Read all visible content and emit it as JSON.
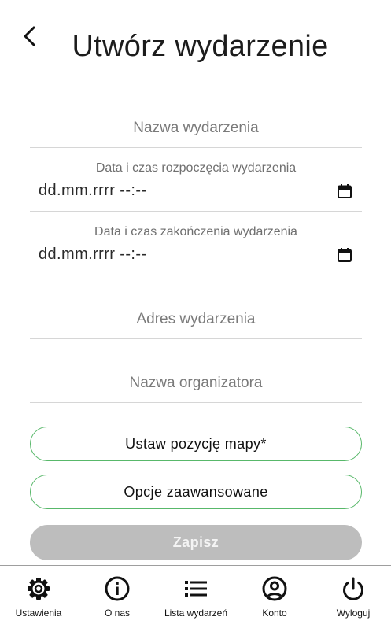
{
  "header": {
    "title": "Utwórz wydarzenie",
    "back_icon": "chevron-left-icon"
  },
  "form": {
    "event_name": {
      "placeholder": "Nazwa wydarzenia",
      "value": ""
    },
    "start_datetime": {
      "label": "Data i czas rozpoczęcia wydarzenia",
      "value": "dd.mm.rrrr --:--",
      "icon": "calendar-icon"
    },
    "end_datetime": {
      "label": "Data i czas zakończenia wydarzenia",
      "value": "dd.mm.rrrr --:--",
      "icon": "calendar-icon"
    },
    "address": {
      "placeholder": "Adres wydarzenia",
      "value": ""
    },
    "organizer": {
      "placeholder": "Nazwa organizatora",
      "value": ""
    },
    "map_button_label": "Ustaw pozycję mapy*",
    "advanced_button_label": "Opcje zaawansowane",
    "save_button_label": "Zapisz"
  },
  "bottom_nav": {
    "items": [
      {
        "label": "Ustawienia",
        "icon": "gear-icon"
      },
      {
        "label": "O nas",
        "icon": "info-icon"
      },
      {
        "label": "Lista wydarzeń",
        "icon": "list-icon"
      },
      {
        "label": "Konto",
        "icon": "account-icon"
      },
      {
        "label": "Wyloguj",
        "icon": "power-icon"
      }
    ]
  },
  "colors": {
    "accent_border": "#58b86a",
    "disabled_button": "#bdbdbd",
    "divider": "#d6d6d6"
  }
}
